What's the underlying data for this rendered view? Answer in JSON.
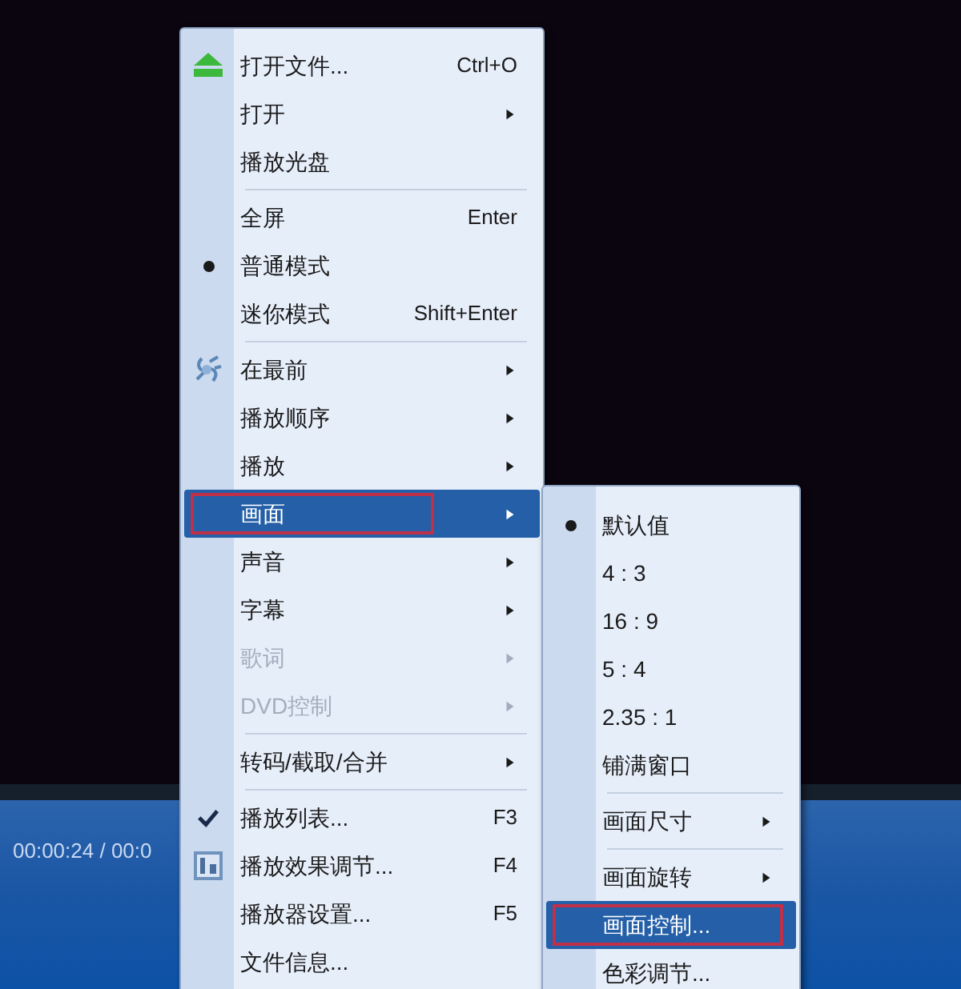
{
  "player": {
    "time": "00:00:24 / 00:0"
  },
  "menu": [
    {
      "kind": "eject",
      "label": "打开文件...",
      "shortcut": "Ctrl+O",
      "checked": false,
      "selected": false,
      "disabled": false,
      "submenu": false
    },
    {
      "kind": "plain",
      "label": "打开",
      "checked": false,
      "selected": false,
      "disabled": false,
      "submenu": true
    },
    {
      "kind": "plain",
      "label": "播放光盘",
      "checked": false,
      "selected": false,
      "disabled": false,
      "submenu": false
    },
    {
      "kind": "separator"
    },
    {
      "kind": "plain",
      "label": "全屏",
      "shortcut": "Enter",
      "checked": false,
      "selected": false,
      "disabled": false,
      "submenu": false
    },
    {
      "kind": "radio",
      "label": "普通模式",
      "checked": true,
      "selected": false,
      "disabled": false,
      "submenu": false
    },
    {
      "kind": "radio",
      "label": "迷你模式",
      "shortcut": "Shift+Enter",
      "checked": false,
      "selected": false,
      "disabled": false,
      "submenu": false
    },
    {
      "kind": "separator"
    },
    {
      "kind": "pin",
      "label": "在最前",
      "checked": false,
      "selected": false,
      "disabled": false,
      "submenu": true
    },
    {
      "kind": "plain",
      "label": "播放顺序",
      "checked": false,
      "selected": false,
      "disabled": false,
      "submenu": true
    },
    {
      "kind": "plain",
      "label": "播放",
      "checked": false,
      "selected": false,
      "disabled": false,
      "submenu": true
    },
    {
      "kind": "plain",
      "label": "画面",
      "checked": false,
      "selected": true,
      "disabled": false,
      "submenu": true
    },
    {
      "kind": "plain",
      "label": "声音",
      "checked": false,
      "selected": false,
      "disabled": false,
      "submenu": true
    },
    {
      "kind": "plain",
      "label": "字幕",
      "checked": false,
      "selected": false,
      "disabled": false,
      "submenu": true
    },
    {
      "kind": "plain",
      "label": "歌词",
      "checked": false,
      "selected": false,
      "disabled": true,
      "submenu": true
    },
    {
      "kind": "plain",
      "label": "DVD控制",
      "checked": false,
      "selected": false,
      "disabled": true,
      "submenu": true
    },
    {
      "kind": "separator"
    },
    {
      "kind": "plain",
      "label": "转码/截取/合并",
      "checked": false,
      "selected": false,
      "disabled": false,
      "submenu": true
    },
    {
      "kind": "separator"
    },
    {
      "kind": "check",
      "label": "播放列表...",
      "shortcut": "F3",
      "checked": true,
      "selected": false,
      "disabled": false,
      "submenu": false
    },
    {
      "kind": "panel",
      "label": "播放效果调节...",
      "shortcut": "F4",
      "checked": false,
      "selected": false,
      "disabled": false,
      "submenu": false
    },
    {
      "kind": "plain",
      "label": "播放器设置...",
      "shortcut": "F5",
      "checked": false,
      "selected": false,
      "disabled": false,
      "submenu": false
    },
    {
      "kind": "plain",
      "label": "文件信息...",
      "checked": false,
      "selected": false,
      "disabled": false,
      "submenu": false
    }
  ],
  "submenu": [
    {
      "kind": "radio",
      "label": "默认值",
      "checked": true,
      "selected": false,
      "submenu": false
    },
    {
      "kind": "radio",
      "label": "4 : 3",
      "checked": false,
      "selected": false,
      "submenu": false
    },
    {
      "kind": "radio",
      "label": "16 : 9",
      "checked": false,
      "selected": false,
      "submenu": false
    },
    {
      "kind": "radio",
      "label": "5 : 4",
      "checked": false,
      "selected": false,
      "submenu": false
    },
    {
      "kind": "radio",
      "label": "2.35 : 1",
      "checked": false,
      "selected": false,
      "submenu": false
    },
    {
      "kind": "radio",
      "label": "铺满窗口",
      "checked": false,
      "selected": false,
      "submenu": false
    },
    {
      "kind": "separator"
    },
    {
      "kind": "plain",
      "label": "画面尺寸",
      "checked": false,
      "selected": false,
      "submenu": true
    },
    {
      "kind": "separator"
    },
    {
      "kind": "plain",
      "label": "画面旋转",
      "checked": false,
      "selected": false,
      "submenu": true
    },
    {
      "kind": "plain",
      "label": "画面控制...",
      "checked": false,
      "selected": true,
      "submenu": false
    },
    {
      "kind": "plain",
      "label": "色彩调节...",
      "checked": false,
      "selected": false,
      "submenu": false
    }
  ]
}
